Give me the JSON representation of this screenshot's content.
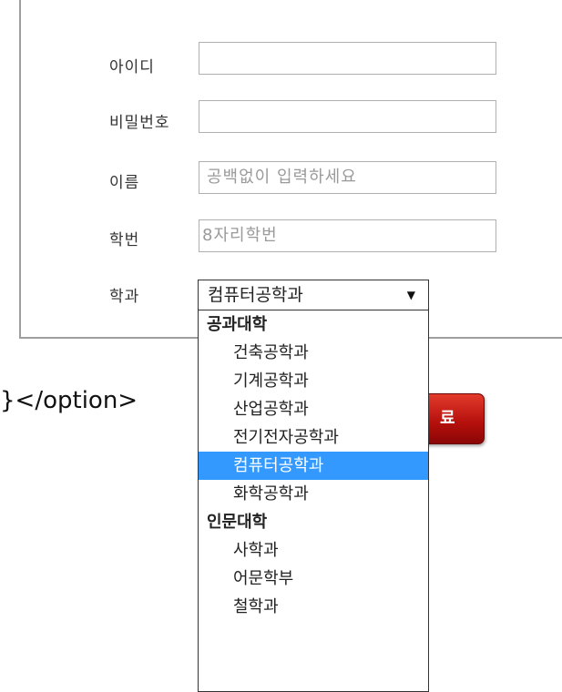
{
  "form": {
    "id_label": "아이디",
    "id_value": "",
    "pw_label": "비밀번호",
    "pw_value": "",
    "name_label": "이름",
    "name_placeholder": "공백없이 입력하세요",
    "student_no_label": "학번",
    "student_no_placeholder": "8자리학번",
    "dept_label": "학과",
    "dept_selected": "컴퓨터공학과"
  },
  "dropdown": {
    "options": [
      {
        "label": "공과대학",
        "kind": "group"
      },
      {
        "label": "건축공학과",
        "kind": "item"
      },
      {
        "label": "기계공학과",
        "kind": "item"
      },
      {
        "label": "산업공학과",
        "kind": "item"
      },
      {
        "label": "전기전자공학과",
        "kind": "item"
      },
      {
        "label": "컴퓨터공학과",
        "kind": "item",
        "selected": true
      },
      {
        "label": "화학공학과",
        "kind": "item"
      },
      {
        "label": "인문대학",
        "kind": "group"
      },
      {
        "label": "사학과",
        "kind": "item"
      },
      {
        "label": "어문학부",
        "kind": "item"
      },
      {
        "label": "철학과",
        "kind": "item"
      }
    ]
  },
  "stray_code_text": "}</option>",
  "submit_button_label": "료",
  "colors": {
    "highlight": "#3399ff",
    "button": "#c0140f",
    "border": "#9e9e9e"
  }
}
